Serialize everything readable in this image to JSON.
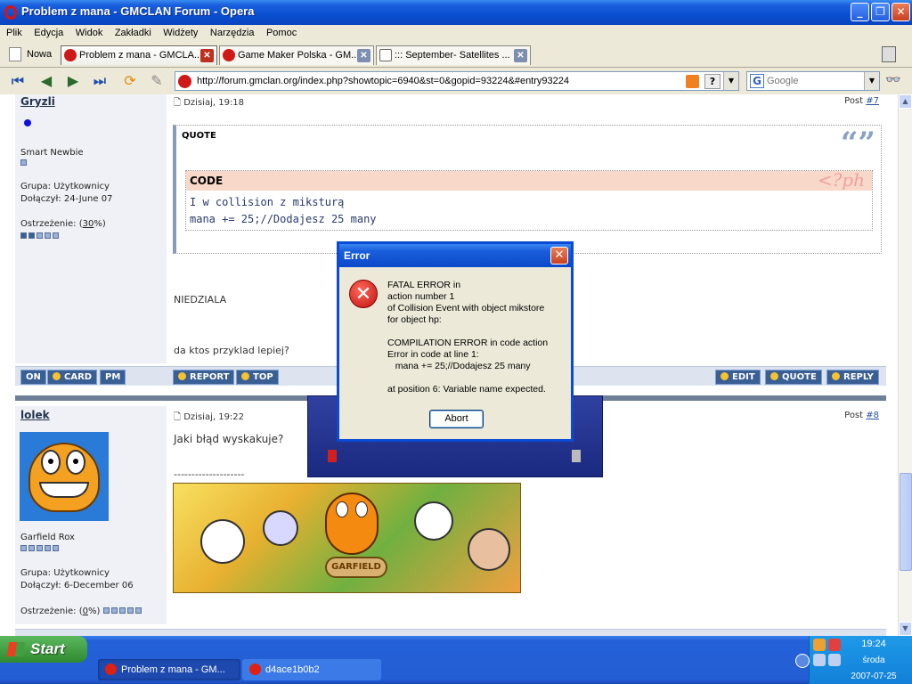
{
  "window": {
    "title": "Problem z mana - GMCLAN Forum - Opera"
  },
  "menu": [
    "Plik",
    "Edycja",
    "Widok",
    "Zakładki",
    "Widżety",
    "Narzędzia",
    "Pomoc"
  ],
  "tabs": {
    "new_label": "Nowa",
    "items": [
      {
        "label": "Problem z mana - GMCLA..."
      },
      {
        "label": "Game Maker Polska - GM..."
      },
      {
        "label": "::: September- Satellites ..."
      }
    ]
  },
  "address": {
    "url": "http://forum.gmclan.org/index.php?showtopic=6940&st=0&gopid=93224&#entry93224",
    "help": "?",
    "search_placeholder": "Google"
  },
  "post1": {
    "user": "Gryzli",
    "date": "Dzisiaj, 19:18",
    "post_label": "Post ",
    "post_num": "#7",
    "rank": "Smart Newbie",
    "group": "Grupa: Użytkownicy",
    "joined": "Dołączył: 24-June 07",
    "warn_prefix": "Ostrzeżenie: (",
    "warn_val": "30",
    "warn_suffix": "%)",
    "quote_label": "QUOTE",
    "code_label": "CODE",
    "code_lines": [
      "I w collision z miksturą",
      "mana += 25;//Dodajesz 25 many"
    ],
    "text1": "NIEDZIALA",
    "text2": "da ktos przyklad lepiej?",
    "buttons_left": [
      "ON",
      "CARD",
      "PM"
    ],
    "buttons_mid": [
      "REPORT",
      "TOP"
    ],
    "buttons_right": [
      "EDIT",
      "QUOTE",
      "REPLY"
    ]
  },
  "post2": {
    "user": "lolek",
    "date": "Dzisiaj, 19:22",
    "post_label": "Post ",
    "post_num": "#8",
    "rank": "Garfield Rox",
    "group": "Grupa: Użytkownicy",
    "joined": "Dołączył: 6-December 06",
    "warn_prefix": "Ostrzeżenie: (",
    "warn_val": "0",
    "warn_suffix": "%)",
    "text": "Jaki błąd wyskakuje?",
    "signature_line": "--------------------"
  },
  "dialog": {
    "title": "Error",
    "message": "FATAL ERROR in\naction number 1\nof Collision Event with object mikstore\nfor object hp:\n\nCOMPILATION ERROR in code action\nError in code at line 1:\n   mana += 25;//Dodajesz 25 many\n\nat position 6: Variable name expected.",
    "button": "Abort"
  },
  "taskbar": {
    "start": "Start",
    "tasks": [
      {
        "label": "Problem z mana - GM..."
      },
      {
        "label": "d4ace1b0b2"
      }
    ],
    "clock": "19:24",
    "day": "środa",
    "date": "2007-07-25"
  }
}
